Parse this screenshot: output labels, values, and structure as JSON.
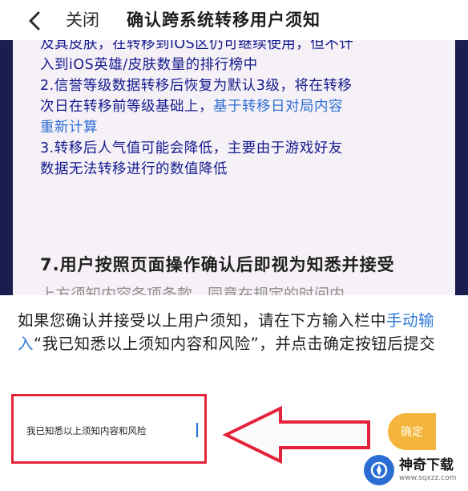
{
  "header": {
    "close_label": "关闭",
    "title": "确认跨系统转移用户须知"
  },
  "document": {
    "line1_prefix": "及其皮肤，在转移到iOS区仍可继续使用，但不计",
    "line2": "入到iOS英雄/皮肤数量的排行榜中",
    "item2_a": "2.信誉等级数据转移后恢复为默认3级，将在转移",
    "item2_b": "次日在转移前等级基础上，",
    "item2_b_blue": "基于转移日对局内容",
    "item2_c_blue": "重新计算",
    "item3_a": "3.转移后人气值可能会降低，主要由于游戏好友",
    "item3_b": "数据无法转移进行的数值降低",
    "section7_title": "7.用户按照页面操作确认后即视为知悉并接受",
    "section7_cut": "上方须知内容各项条款，同意在规定的时间内"
  },
  "instruction": {
    "part1": "如果您确认并接受以上用户须知，请在下方输入栏中",
    "link": "手动输入",
    "part2": "“我已知悉以上须知内容和风险”，并点击确定按钮后提交"
  },
  "confirm_input": {
    "value": "我已知悉以上须知内容和风险"
  },
  "submit": {
    "label": "确定"
  },
  "watermark": {
    "name": "神奇下载",
    "url": "www.sqxzz.com"
  },
  "colors": {
    "highlight": "#e4233a",
    "link": "#2f7ad8",
    "submit": "#f3b53d"
  }
}
